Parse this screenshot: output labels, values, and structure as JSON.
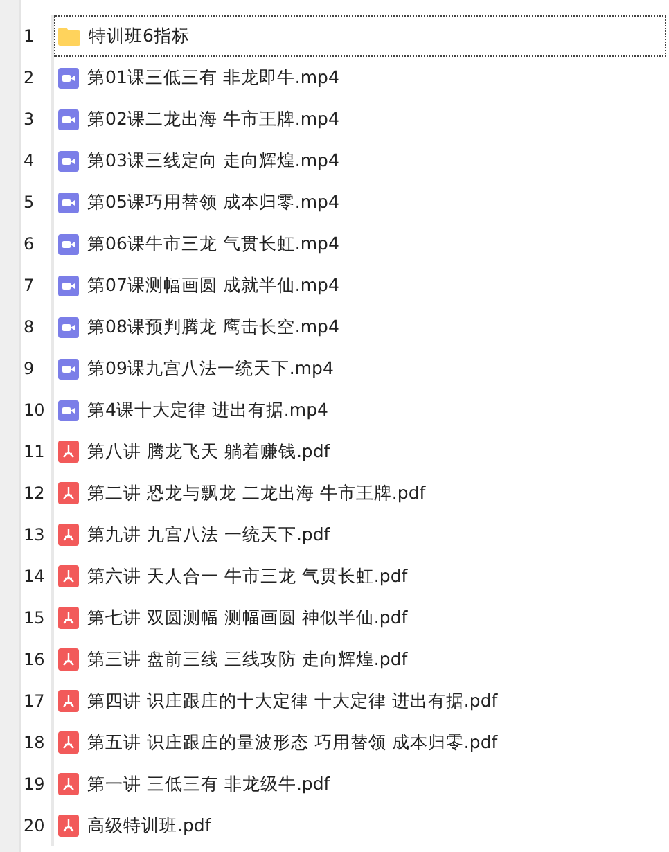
{
  "rows": [
    {
      "number": "1",
      "kind": "folder",
      "name": "特训班6指标",
      "selected": true
    },
    {
      "number": "2",
      "kind": "video",
      "name": "第01课三低三有 非龙即牛.mp4",
      "selected": false
    },
    {
      "number": "3",
      "kind": "video",
      "name": "第02课二龙出海 牛市王牌.mp4",
      "selected": false
    },
    {
      "number": "4",
      "kind": "video",
      "name": "第03课三线定向 走向辉煌.mp4",
      "selected": false
    },
    {
      "number": "5",
      "kind": "video",
      "name": "第05课巧用替领 成本归零.mp4",
      "selected": false
    },
    {
      "number": "6",
      "kind": "video",
      "name": "第06课牛市三龙 气贯长虹.mp4",
      "selected": false
    },
    {
      "number": "7",
      "kind": "video",
      "name": "第07课测幅画圆 成就半仙.mp4",
      "selected": false
    },
    {
      "number": "8",
      "kind": "video",
      "name": "第08课预判腾龙 鹰击长空.mp4",
      "selected": false
    },
    {
      "number": "9",
      "kind": "video",
      "name": "第09课九宫八法一统天下.mp4",
      "selected": false
    },
    {
      "number": "10",
      "kind": "video",
      "name": "第4课十大定律 进出有据.mp4",
      "selected": false
    },
    {
      "number": "11",
      "kind": "pdf",
      "name": "第八讲 腾龙飞天 躺着赚钱.pdf",
      "selected": false
    },
    {
      "number": "12",
      "kind": "pdf",
      "name": "第二讲 恐龙与飘龙 二龙出海 牛市王牌.pdf",
      "selected": false
    },
    {
      "number": "13",
      "kind": "pdf",
      "name": "第九讲 九宫八法 一统天下.pdf",
      "selected": false
    },
    {
      "number": "14",
      "kind": "pdf",
      "name": "第六讲 天人合一 牛市三龙 气贯长虹.pdf",
      "selected": false
    },
    {
      "number": "15",
      "kind": "pdf",
      "name": "第七讲 双圆测幅 测幅画圆 神似半仙.pdf",
      "selected": false
    },
    {
      "number": "16",
      "kind": "pdf",
      "name": "第三讲 盘前三线 三线攻防 走向辉煌.pdf",
      "selected": false
    },
    {
      "number": "17",
      "kind": "pdf",
      "name": "第四讲 识庄跟庄的十大定律 十大定律 进出有据.pdf",
      "selected": false
    },
    {
      "number": "18",
      "kind": "pdf",
      "name": "第五讲 识庄跟庄的量波形态 巧用替领 成本归零.pdf",
      "selected": false
    },
    {
      "number": "19",
      "kind": "pdf",
      "name": "第一讲 三低三有 非龙级牛.pdf",
      "selected": false
    },
    {
      "number": "20",
      "kind": "pdf",
      "name": "高级特训班.pdf",
      "selected": false
    }
  ]
}
